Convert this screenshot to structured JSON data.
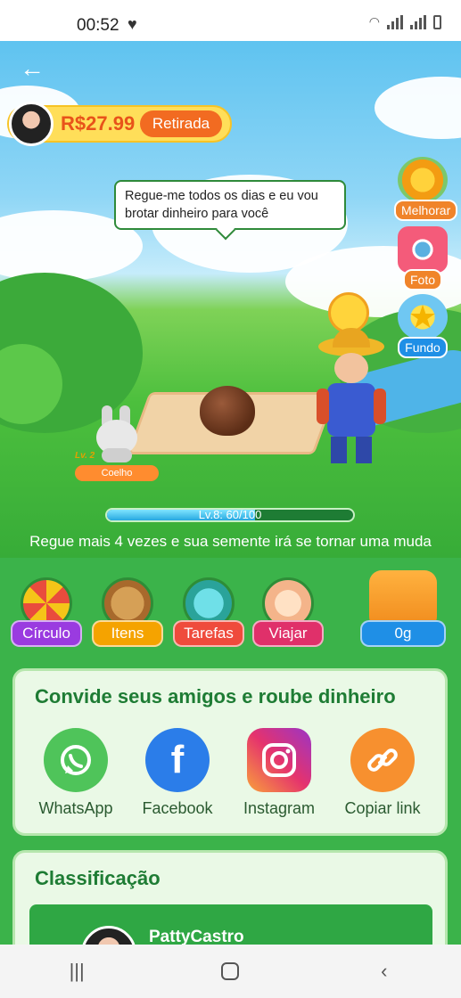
{
  "status_bar": {
    "time": "00:52"
  },
  "header": {
    "balance": "R$27.99",
    "withdraw_label": "Retirada"
  },
  "bubble": {
    "text": "Regue-me todos os dias e eu vou brotar dinheiro para você"
  },
  "side_buttons": [
    {
      "label": "Melhorar"
    },
    {
      "label": "Foto"
    },
    {
      "label": "Fundo"
    }
  ],
  "pet": {
    "level": "Lv. 2",
    "name": "Coelho"
  },
  "progress": {
    "text": "Lv.8: 60/100",
    "value": 0.6
  },
  "hint": "Regue mais 4 vezes e sua semente irá se tornar uma muda",
  "tools": [
    {
      "label": "Círculo",
      "color": "#9a3be0"
    },
    {
      "label": "Itens",
      "color": "#f5a300"
    },
    {
      "label": "Tarefas",
      "color": "#ef4b3c"
    },
    {
      "label": "Viajar",
      "color": "#e0306a"
    },
    {
      "label": "0g",
      "color": "#1f8fe6"
    }
  ],
  "invite": {
    "title": "Convide seus amigos e roube dinheiro",
    "options": [
      {
        "label": "WhatsApp",
        "color": "#4fc45a"
      },
      {
        "label": "Facebook",
        "color": "#2b7de9"
      },
      {
        "label": "Instagram",
        "color": "#d62e8a"
      },
      {
        "label": "Copiar link",
        "color": "#f7902f"
      }
    ]
  },
  "ranking": {
    "title": "Classificação",
    "first_name": "PattyCastro"
  }
}
